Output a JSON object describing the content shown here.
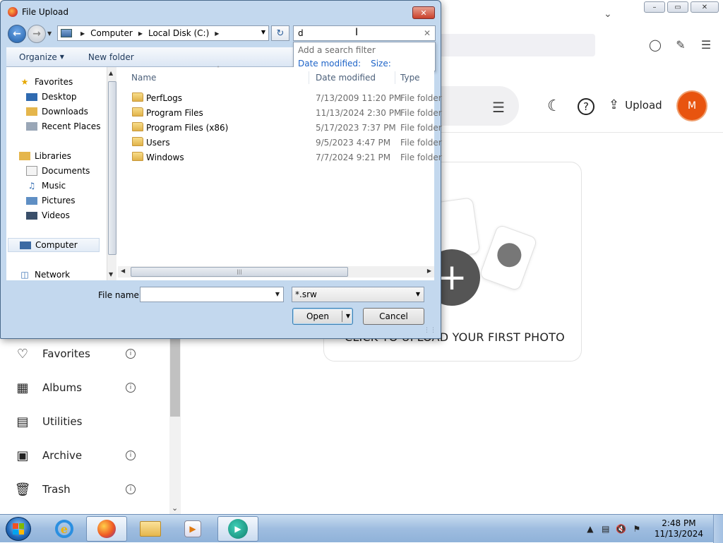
{
  "browser": {
    "window_controls": {
      "minimize": "–",
      "maximize": "▭",
      "close": "✕"
    }
  },
  "app": {
    "header": {
      "upload_label": "Upload",
      "avatar_initial": "M"
    },
    "sidebar": {
      "items": [
        {
          "label": "Favorites",
          "icon": "heart-icon",
          "has_info": true
        },
        {
          "label": "Albums",
          "icon": "albums-icon",
          "has_info": true
        },
        {
          "label": "Utilities",
          "icon": "toolbox-icon",
          "has_info": false
        },
        {
          "label": "Archive",
          "icon": "archive-icon",
          "has_info": true
        },
        {
          "label": "Trash",
          "icon": "trash-icon",
          "has_info": true
        }
      ]
    },
    "upload_card": {
      "text": "CLICK TO UPLOAD YOUR FIRST PHOTO"
    },
    "colors": {
      "avatar": "#e8540f",
      "plus_circle": "#555555"
    }
  },
  "dialog": {
    "title": "File Upload",
    "close": "✕",
    "breadcrumb": [
      "Computer",
      "Local Disk (C:)"
    ],
    "search_value": "d",
    "search_suggest": {
      "hint": "Add a search filter",
      "filters": [
        "Date modified:",
        "Size:"
      ]
    },
    "toolbar": {
      "organize": "Organize",
      "new_folder": "New folder"
    },
    "nav": {
      "favorites": {
        "label": "Favorites",
        "items": [
          "Desktop",
          "Downloads",
          "Recent Places"
        ]
      },
      "libraries": {
        "label": "Libraries",
        "items": [
          "Documents",
          "Music",
          "Pictures",
          "Videos"
        ]
      },
      "computer": "Computer",
      "network": "Network"
    },
    "columns": {
      "name": "Name",
      "date": "Date modified",
      "type": "Type"
    },
    "files": [
      {
        "name": "PerfLogs",
        "date": "7/13/2009 11:20 PM",
        "type": "File folder"
      },
      {
        "name": "Program Files",
        "date": "11/13/2024 2:30 PM",
        "type": "File folder"
      },
      {
        "name": "Program Files (x86)",
        "date": "5/17/2023 7:37 PM",
        "type": "File folder"
      },
      {
        "name": "Users",
        "date": "9/5/2023 4:47 PM",
        "type": "File folder"
      },
      {
        "name": "Windows",
        "date": "7/7/2024 9:21 PM",
        "type": "File folder"
      }
    ],
    "file_name_label": "File name:",
    "file_name_value": "",
    "filter_value": "*.srw",
    "open_label": "Open",
    "cancel_label": "Cancel"
  },
  "taskbar": {
    "clock_time": "2:48 PM",
    "clock_date": "11/13/2024"
  }
}
